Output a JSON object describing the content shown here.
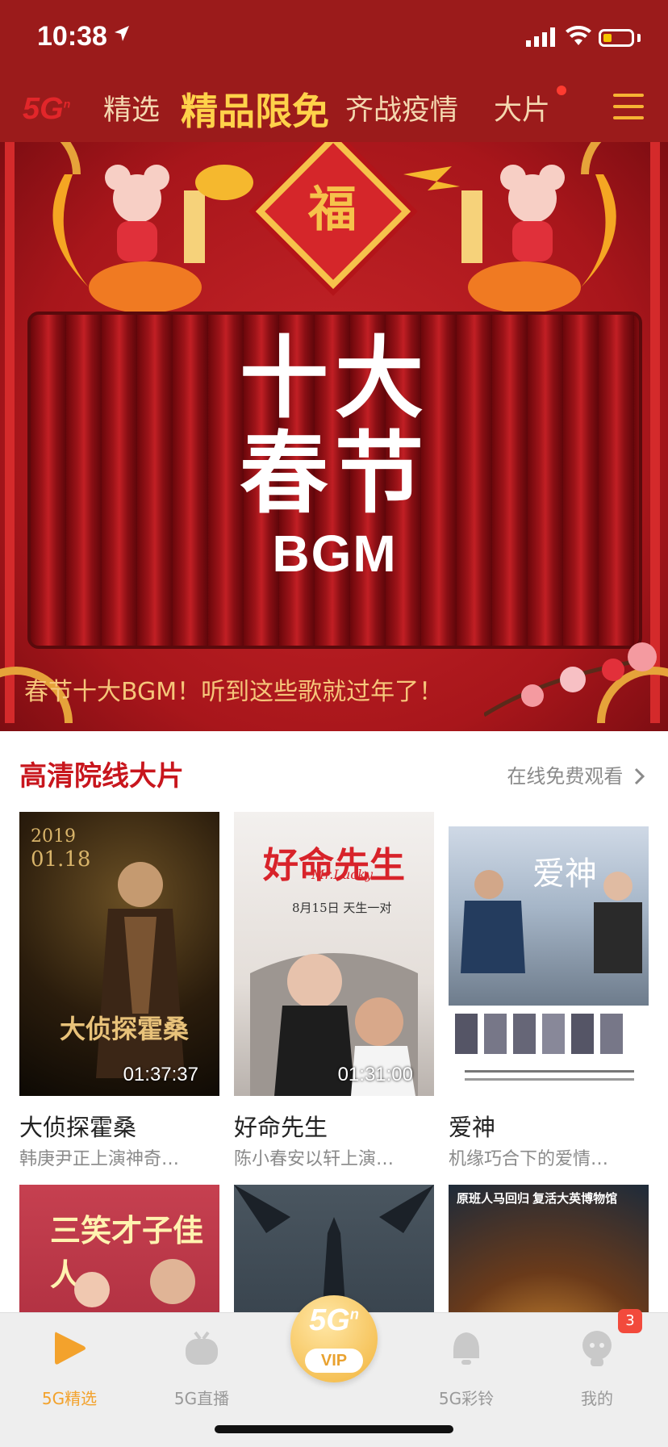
{
  "status": {
    "time": "10:38"
  },
  "nav": {
    "logo": "5G",
    "tabs": [
      {
        "label": "精选"
      },
      {
        "label": "精品限免"
      },
      {
        "label": "齐战疫情"
      },
      {
        "label": "大片"
      }
    ]
  },
  "banner": {
    "fu_char": "福",
    "title_line1": "十大",
    "title_line2": "春节",
    "title_line3": "BGM",
    "caption": "春节十大BGM！听到这些歌就过年了！"
  },
  "section": {
    "title": "高清院线大片",
    "more": "在线免费观看"
  },
  "movies": [
    {
      "title": "大侦探霍桑",
      "desc": "韩庚尹正上演神奇…",
      "duration": "01:37:37"
    },
    {
      "title": "好命先生",
      "desc": "陈小春安以轩上演…",
      "duration": "01:31:00"
    },
    {
      "title": "爱神",
      "desc": "机缘巧合下的爱情…"
    }
  ],
  "posters": {
    "p1_year": "2019",
    "p1_date": "01.18",
    "p1_name": "大侦探霍桑",
    "p2_name": "好命先生",
    "p2_sub": "Mr.Lucky",
    "p2_tag": "8月15日 天生一对",
    "p3_name": "爱神",
    "p4_name": "三笑才子佳人",
    "p6_tag": "原班人马回归 复活大英博物馆"
  },
  "tabbar": {
    "items": [
      {
        "label": "5G精选",
        "icon": "play-icon"
      },
      {
        "label": "5G直播",
        "icon": "tv-icon"
      },
      {
        "label": "5G彩铃",
        "icon": "bell-icon"
      },
      {
        "label": "我的",
        "icon": "user-icon"
      }
    ],
    "vip_label": "VIP",
    "vip_5g": "5G",
    "badge": "3"
  },
  "colors": {
    "nav_bg": "#9b1b1b",
    "accent": "#ffd24a",
    "section_title": "#c8161d",
    "tab_active": "#f3a22c"
  }
}
